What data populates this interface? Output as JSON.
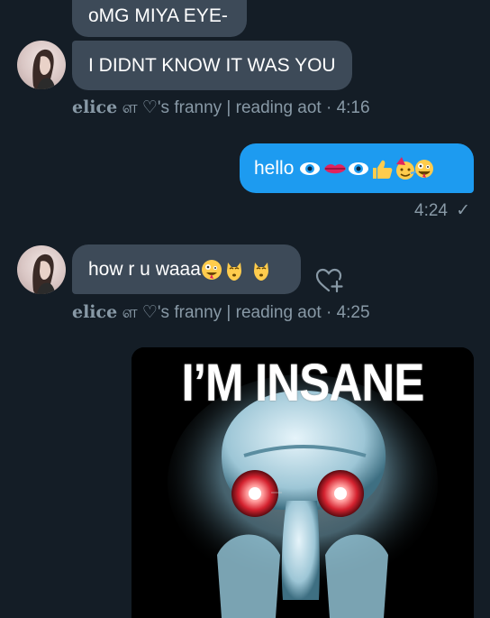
{
  "messages": {
    "msg1": {
      "text": "oMG MIYA EYE-"
    },
    "msg2": {
      "text": "I DIDNT KNOW IT WAS YOU"
    },
    "meta1": {
      "name": "elice",
      "rest": "ள ♡'s franny | reading aot · 4:16"
    },
    "msg3": {
      "text": "hello "
    },
    "status3": {
      "time": "4:24",
      "check": "✓"
    },
    "msg4": {
      "text": "how r u waaa"
    },
    "meta2": {
      "name": "elice",
      "rest": "ள ♡'s franny | reading aot · 4:25"
    },
    "meme": {
      "caption": "I’M INSANE"
    }
  },
  "icons": {
    "react": "heart-plus-icon",
    "avatar": "avatar"
  },
  "colors": {
    "background": "#141d26",
    "incoming_bubble": "#3d4a58",
    "outgoing_bubble": "#1d9bf0",
    "meta_text": "#8899a6"
  }
}
